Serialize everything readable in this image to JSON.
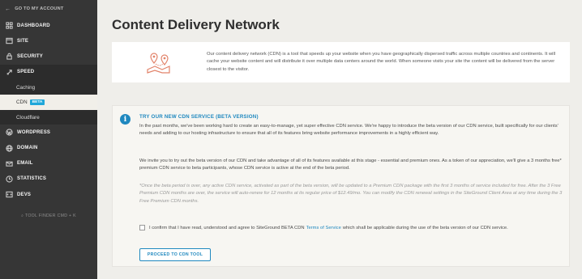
{
  "sidebar": {
    "back_label": "GO TO MY ACCOUNT",
    "items": [
      {
        "label": "DASHBOARD",
        "icon": "grid-icon"
      },
      {
        "label": "SITE",
        "icon": "window-icon"
      },
      {
        "label": "SECURITY",
        "icon": "lock-icon"
      },
      {
        "label": "SPEED",
        "icon": "rocket-icon"
      },
      {
        "label": "WORDPRESS",
        "icon": "wordpress-icon"
      },
      {
        "label": "DOMAIN",
        "icon": "globe-icon"
      },
      {
        "label": "EMAIL",
        "icon": "envelope-icon"
      },
      {
        "label": "STATISTICS",
        "icon": "clock-chart-icon"
      },
      {
        "label": "DEVS",
        "icon": "code-icon"
      }
    ],
    "speed_sub": [
      {
        "label": "Caching"
      },
      {
        "label": "CDN",
        "badge": "BETA"
      },
      {
        "label": "Cloudflare"
      }
    ],
    "tool_finder": "TOOL FINDER CMD + K"
  },
  "main": {
    "title": "Content Delivery Network",
    "intro": "Our content delivery network (CDN) is a tool that speeds up your website when you have geographically dispersed traffic across multiple countries and continents. It will cache your website content and will distribute it over multiple data centers around the world. When someone visits your site the content will be delivered from the server closest to the visitor.",
    "beta": {
      "heading": "TRY OUR NEW CDN SERVICE (BETA VERSION)",
      "p1": "In the past months, we've been working hard to create an easy-to-manage, yet super effective CDN service. We're happy to introduce the beta version of our CDN service, built specifically for our clients' needs and adding to our hosting infrastructure to ensure that all of its features bring website performance improvements in a highly efficient way.",
      "p2": "We invite you to try out the beta version of our CDN and take advantage of all of its features available at this stage - essential and premium ones. As a token of our appreciation, we'll give a 3 months free* premium CDN service to beta participants, whose CDN service is active at the end of the beta period.",
      "note": "*Once the beta period is over, any active CDN service, activated as part of the beta version, will be updated to a Premium CDN package with the first 3 months of service included for free. After the 3 Free Premium CDN months are over, the service will auto-renew for 12 months at its regular price of $12.49/mo. You can modify the CDN renewal settings in the SiteGround Client Area at any time during the 3 Free Premium CDN months.",
      "confirm_before": "I confirm that I have read, understood and agree to SiteGround BETA CDN",
      "confirm_link": "Terms of Service",
      "confirm_after": "which shall be applicable during the use of the beta version of our CDN service.",
      "button": "PROCEED TO CDN TOOL"
    }
  },
  "colors": {
    "sidebar_bg": "#363636",
    "accent": "#1f88bf",
    "beta_badge": "#1fa7d9",
    "map_icon": "#e2836a"
  }
}
